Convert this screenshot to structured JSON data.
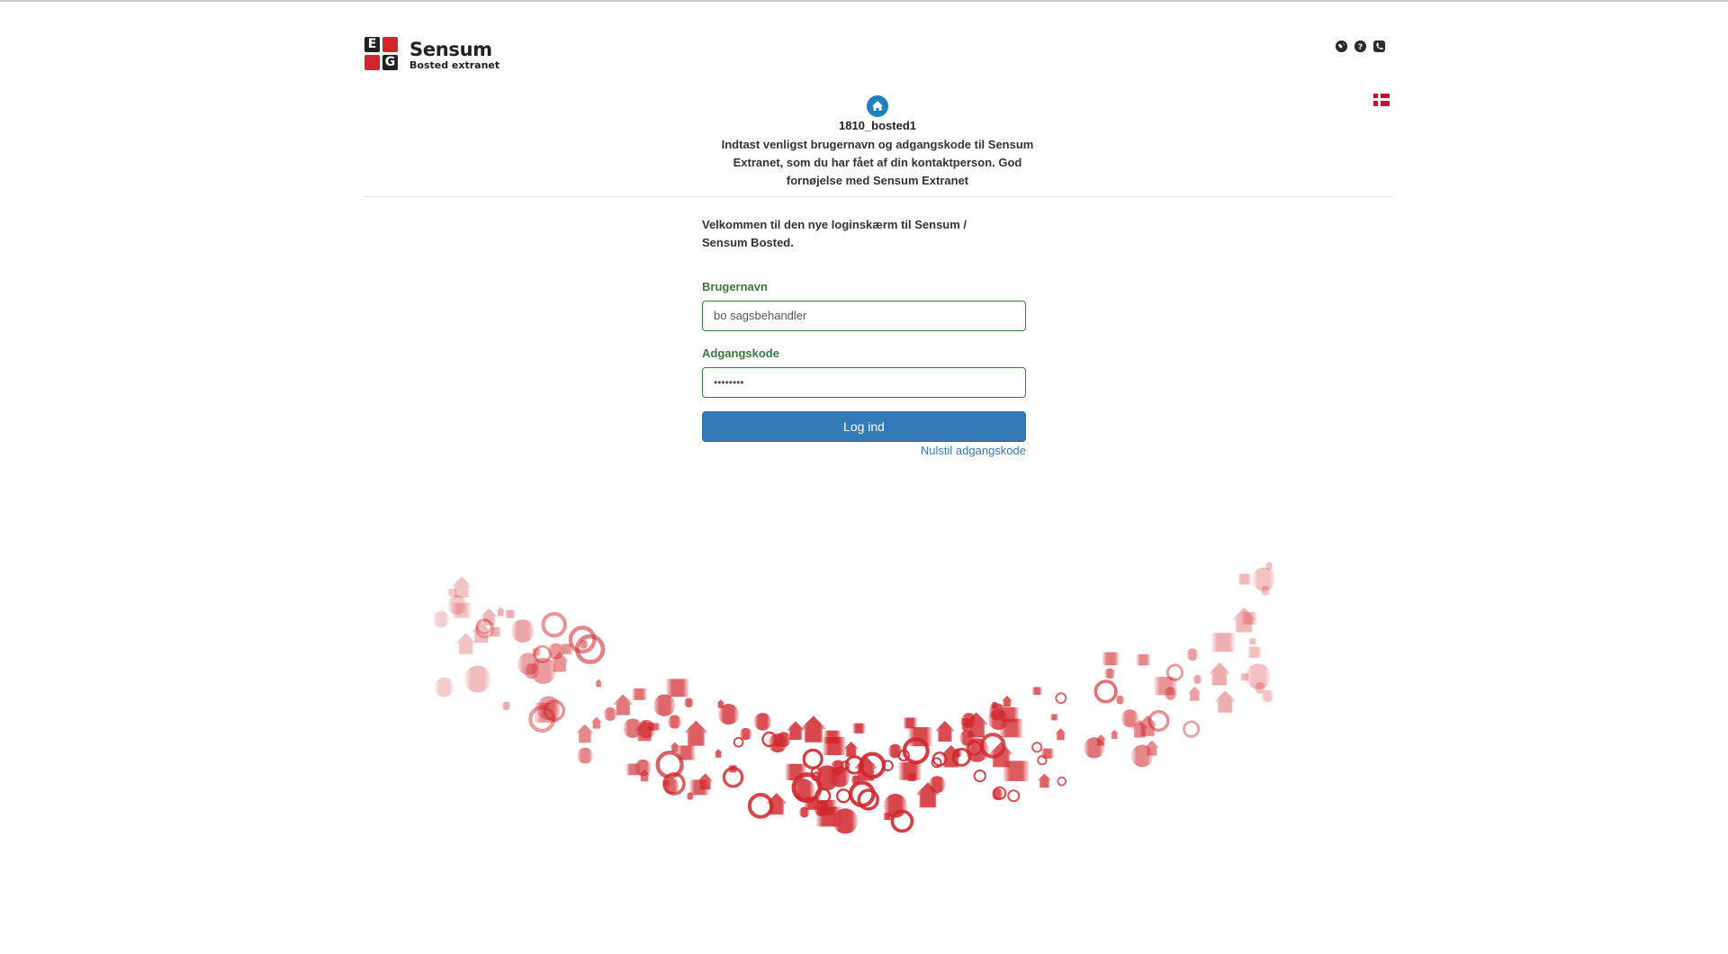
{
  "brand": {
    "logo_letters": [
      "E",
      "G"
    ],
    "title": "Sensum",
    "subtitle": "Bosted extranet"
  },
  "header_icons": [
    "globe-icon",
    "help-icon",
    "phone-icon"
  ],
  "language": {
    "flag": "danish-flag-icon"
  },
  "org": {
    "name": "1810_bosted1"
  },
  "intro": "Indtast venligst brugernavn og adgangskode til Sensum Extranet, som du har fået af din kontaktperson. God fornøjelse med Sensum Extranet",
  "form": {
    "welcome": "Velkommen til den nye loginskærm til Sensum / Sensum Bosted.",
    "username_label": "Brugernavn",
    "username_value": "bo sagsbehandler",
    "password_label": "Adgangskode",
    "password_value": "••••••••",
    "login_button": "Log ind",
    "reset_link": "Nulstil adgangskode"
  },
  "colors": {
    "brand_red": "#d0262c",
    "primary_button": "#337ab7",
    "label_green": "#3c763d",
    "icon_badge": "#1f7fc0"
  }
}
